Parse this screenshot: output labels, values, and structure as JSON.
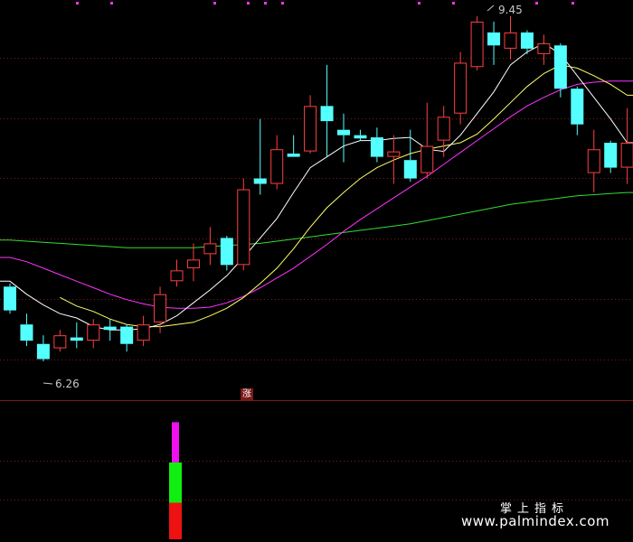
{
  "chart_data": [
    {
      "type": "candlestick",
      "price_range": [
        5.9,
        9.6
      ],
      "annotations": {
        "high_label": "9.45",
        "low_label": "6.26"
      },
      "colors": {
        "up": "#ff4040",
        "down": "#54ffff",
        "ma5": "#ffffff",
        "ma10": "#ffff66",
        "ma20": "#ff33ff",
        "ma60": "#33dd33"
      },
      "candles": [
        {
          "o": 6.95,
          "h": 6.98,
          "l": 6.7,
          "c": 6.73
        },
        {
          "o": 6.6,
          "h": 6.7,
          "l": 6.4,
          "c": 6.45
        },
        {
          "o": 6.42,
          "h": 6.5,
          "l": 6.26,
          "c": 6.28
        },
        {
          "o": 6.38,
          "h": 6.55,
          "l": 6.35,
          "c": 6.5
        },
        {
          "o": 6.48,
          "h": 6.62,
          "l": 6.38,
          "c": 6.45
        },
        {
          "o": 6.45,
          "h": 6.65,
          "l": 6.38,
          "c": 6.6
        },
        {
          "o": 6.58,
          "h": 6.65,
          "l": 6.45,
          "c": 6.55
        },
        {
          "o": 6.58,
          "h": 6.6,
          "l": 6.35,
          "c": 6.42
        },
        {
          "o": 6.45,
          "h": 6.68,
          "l": 6.4,
          "c": 6.6
        },
        {
          "o": 6.62,
          "h": 6.95,
          "l": 6.52,
          "c": 6.88
        },
        {
          "o": 7.0,
          "h": 7.2,
          "l": 6.95,
          "c": 7.1
        },
        {
          "o": 7.12,
          "h": 7.35,
          "l": 7.0,
          "c": 7.2
        },
        {
          "o": 7.25,
          "h": 7.5,
          "l": 7.15,
          "c": 7.35
        },
        {
          "o": 7.4,
          "h": 7.42,
          "l": 7.1,
          "c": 7.15
        },
        {
          "o": 7.15,
          "h": 7.95,
          "l": 7.1,
          "c": 7.85
        },
        {
          "o": 7.95,
          "h": 8.5,
          "l": 7.8,
          "c": 7.9
        },
        {
          "o": 7.9,
          "h": 8.35,
          "l": 7.85,
          "c": 8.22
        },
        {
          "o": 8.18,
          "h": 8.35,
          "l": 8.15,
          "c": 8.15
        },
        {
          "o": 8.2,
          "h": 8.72,
          "l": 8.18,
          "c": 8.62
        },
        {
          "o": 8.62,
          "h": 9.0,
          "l": 8.15,
          "c": 8.48
        },
        {
          "o": 8.4,
          "h": 8.55,
          "l": 8.1,
          "c": 8.35
        },
        {
          "o": 8.35,
          "h": 8.4,
          "l": 8.3,
          "c": 8.32
        },
        {
          "o": 8.33,
          "h": 8.42,
          "l": 8.1,
          "c": 8.15
        },
        {
          "o": 8.15,
          "h": 8.35,
          "l": 7.9,
          "c": 8.2
        },
        {
          "o": 8.12,
          "h": 8.4,
          "l": 7.92,
          "c": 7.95
        },
        {
          "o": 8.0,
          "h": 8.65,
          "l": 7.95,
          "c": 8.25
        },
        {
          "o": 8.3,
          "h": 8.62,
          "l": 8.15,
          "c": 8.52
        },
        {
          "o": 8.55,
          "h": 9.12,
          "l": 8.45,
          "c": 9.02
        },
        {
          "o": 8.98,
          "h": 9.45,
          "l": 8.95,
          "c": 9.4
        },
        {
          "o": 9.3,
          "h": 9.4,
          "l": 9.0,
          "c": 9.18
        },
        {
          "o": 9.15,
          "h": 9.45,
          "l": 9.05,
          "c": 9.3
        },
        {
          "o": 9.3,
          "h": 9.32,
          "l": 9.1,
          "c": 9.15
        },
        {
          "o": 9.1,
          "h": 9.28,
          "l": 9.0,
          "c": 9.2
        },
        {
          "o": 9.18,
          "h": 9.2,
          "l": 8.7,
          "c": 8.78
        },
        {
          "o": 8.78,
          "h": 8.8,
          "l": 8.35,
          "c": 8.45
        },
        {
          "o": 8.0,
          "h": 8.4,
          "l": 7.82,
          "c": 8.22
        },
        {
          "o": 8.28,
          "h": 8.3,
          "l": 8.0,
          "c": 8.05
        },
        {
          "o": 8.05,
          "h": 8.6,
          "l": 7.9,
          "c": 8.28
        }
      ],
      "ma5": [
        7.0,
        6.88,
        6.78,
        6.7,
        6.66,
        6.58,
        6.55,
        6.55,
        6.56,
        6.6,
        6.68,
        6.8,
        6.92,
        7.05,
        7.22,
        7.4,
        7.58,
        7.82,
        8.05,
        8.15,
        8.25,
        8.3,
        8.3,
        8.32,
        8.33,
        8.22,
        8.2,
        8.35,
        8.55,
        8.75,
        9.0,
        9.12,
        9.2,
        9.1,
        8.9,
        8.7,
        8.5,
        8.28
      ],
      "ma10": [
        null,
        null,
        null,
        6.85,
        6.77,
        6.72,
        6.65,
        6.6,
        6.58,
        6.58,
        6.6,
        6.62,
        6.68,
        6.75,
        6.85,
        6.98,
        7.12,
        7.3,
        7.5,
        7.68,
        7.82,
        7.95,
        8.05,
        8.12,
        8.18,
        8.22,
        8.25,
        8.28,
        8.36,
        8.5,
        8.65,
        8.8,
        8.92,
        9.0,
        8.97,
        8.9,
        8.82,
        8.72
      ],
      "ma20": [
        7.22,
        7.18,
        7.12,
        7.06,
        7.0,
        6.94,
        6.88,
        6.83,
        6.79,
        6.76,
        6.75,
        6.75,
        6.76,
        6.8,
        6.86,
        6.94,
        7.03,
        7.12,
        7.23,
        7.34,
        7.46,
        7.57,
        7.67,
        7.77,
        7.87,
        7.97,
        8.08,
        8.19,
        8.3,
        8.41,
        8.52,
        8.62,
        8.7,
        8.77,
        8.82,
        8.84,
        8.85,
        8.85
      ],
      "ma60": [
        7.38,
        7.37,
        7.36,
        7.35,
        7.34,
        7.33,
        7.32,
        7.31,
        7.31,
        7.31,
        7.31,
        7.31,
        7.32,
        7.33,
        7.34,
        7.35,
        7.37,
        7.39,
        7.41,
        7.43,
        7.45,
        7.47,
        7.49,
        7.51,
        7.53,
        7.56,
        7.59,
        7.62,
        7.65,
        7.68,
        7.71,
        7.73,
        7.75,
        7.77,
        7.79,
        7.8,
        7.81,
        7.82
      ]
    },
    {
      "type": "bar",
      "bars": [
        {
          "candle_index": 10,
          "segments": [
            {
              "value": 0.3,
              "color": "#ee1111"
            },
            {
              "value": 0.33,
              "color": "#11ee11"
            },
            {
              "value": 0.33,
              "color": "#ee11ee"
            }
          ]
        }
      ]
    }
  ],
  "badge": {
    "text": "涨"
  },
  "watermark": {
    "line1": "掌上指标",
    "line2": "www.palmindex.com"
  }
}
